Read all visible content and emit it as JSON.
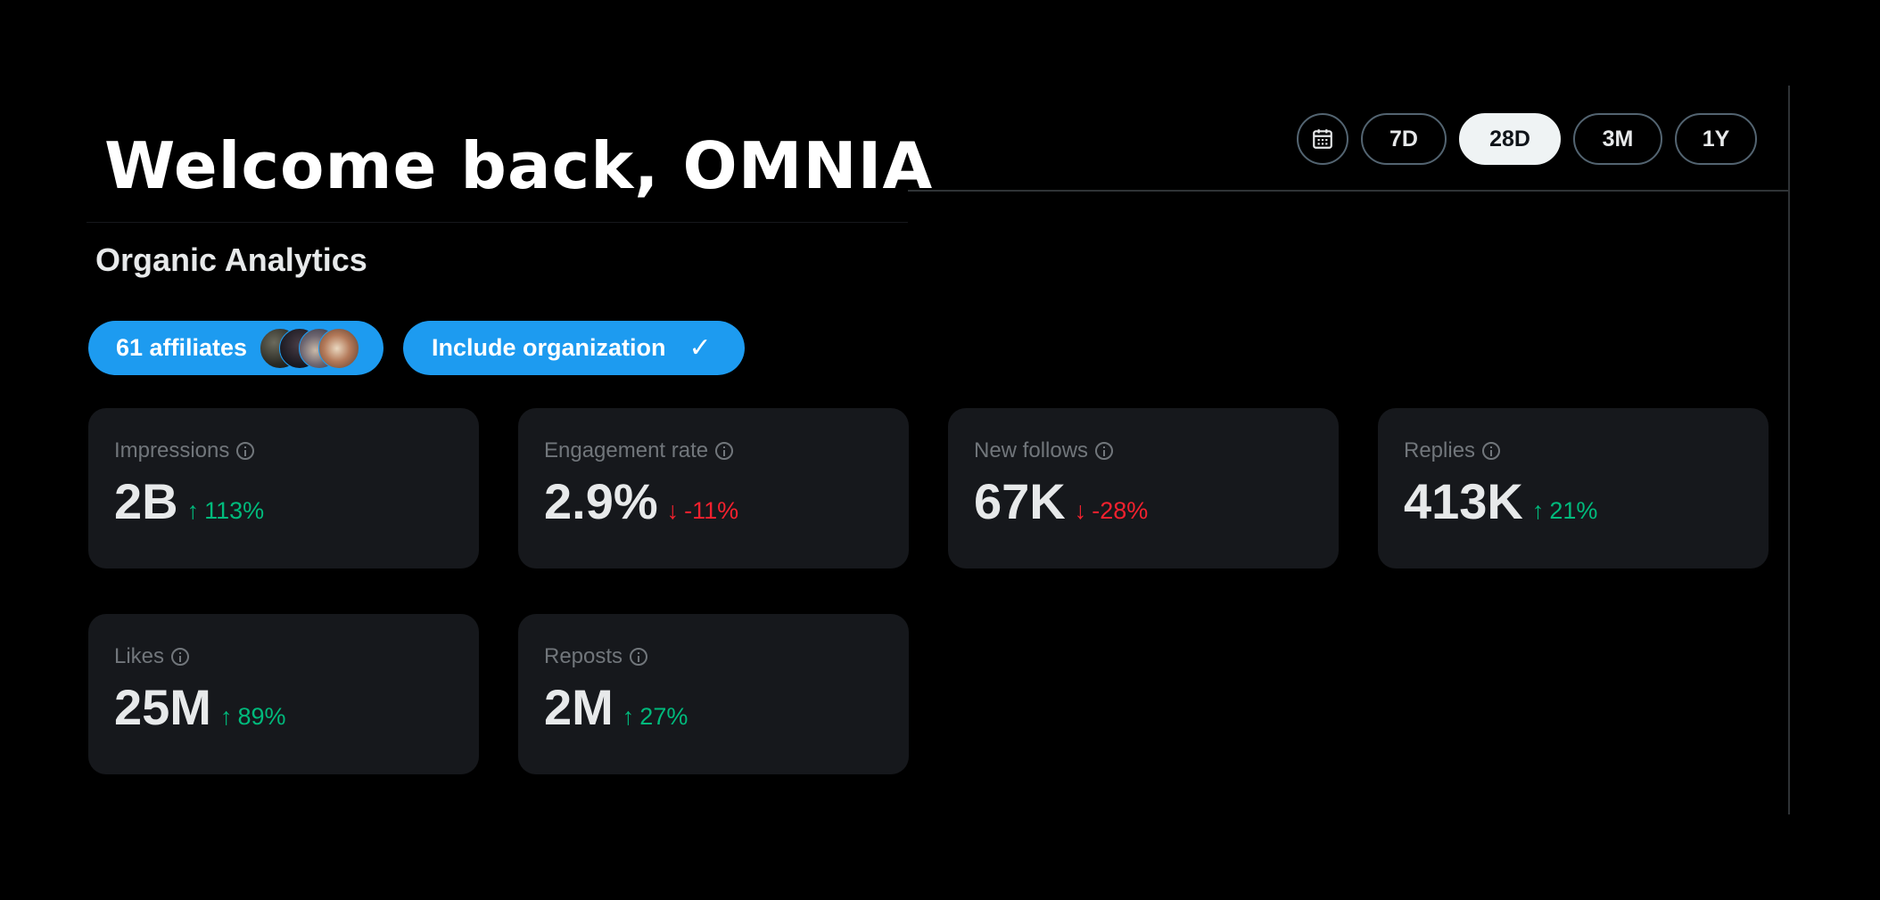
{
  "header": {
    "welcome": "Welcome back, OMNIA",
    "subtitle": "Organic Analytics"
  },
  "range": {
    "calendar_icon": "calendar-icon",
    "options": [
      "7D",
      "28D",
      "3M",
      "1Y"
    ],
    "selected": "28D"
  },
  "filters": {
    "affiliates_label": "61 affiliates",
    "include_label": "Include organization",
    "include_checked": true,
    "check_glyph": "✓"
  },
  "metrics": [
    {
      "label": "Impressions",
      "value": "2B",
      "change": "113%",
      "direction": "up",
      "arrow": "↑"
    },
    {
      "label": "Engagement rate",
      "value": "2.9%",
      "change": "-11%",
      "direction": "down",
      "arrow": "↓"
    },
    {
      "label": "New follows",
      "value": "67K",
      "change": "-28%",
      "direction": "down",
      "arrow": "↓"
    },
    {
      "label": "Replies",
      "value": "413K",
      "change": "21%",
      "direction": "up",
      "arrow": "↑"
    },
    {
      "label": "Likes",
      "value": "25M",
      "change": "89%",
      "direction": "up",
      "arrow": "↑"
    },
    {
      "label": "Reposts",
      "value": "2M",
      "change": "27%",
      "direction": "up",
      "arrow": "↑"
    }
  ],
  "colors": {
    "background": "#000000",
    "card": "#16181c",
    "accent": "#1d9bf0",
    "positive": "#00ba7c",
    "negative": "#f4212e",
    "muted": "#71767b"
  }
}
